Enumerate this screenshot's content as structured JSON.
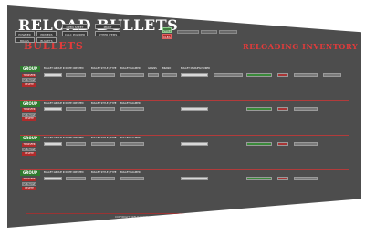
{
  "header": {
    "title": "RELOAD BULLETS",
    "section_title": "BULLETS",
    "inventory_title": "RELOADING INVENTORY"
  },
  "top_buttons": [
    "POWDER",
    "PRIMERS",
    "BRASS",
    "BULLETS",
    "OPEN SHEET",
    "CALC POWDER",
    "OTHER ITEMS",
    "SAVE",
    "CLEAR",
    "PRINT"
  ],
  "group_rows": [
    {
      "label": "GROUP",
      "side": [
        "TRANSFER",
        "PURCHASE",
        "DELETE"
      ]
    },
    {
      "label": "GROUP",
      "side": [
        "TRANSFER",
        "PURCHASE",
        "DELETE"
      ]
    },
    {
      "label": "GROUP",
      "side": [
        "TRANSFER",
        "PURCHASE",
        "DELETE"
      ]
    },
    {
      "label": "GROUP",
      "side": [
        "TRANSFER",
        "PURCHASE",
        "DELETE"
      ]
    }
  ],
  "columns": [
    "BULLET GROUP ID",
    "DATE CREATED",
    "BULLET STYLE / TYPE",
    "BULLET CALIBER",
    "GRAINS",
    "BRAND",
    "BULLET MANUFACTURER"
  ],
  "footer": "COPYRIGHT RELOADING INVENTORY"
}
